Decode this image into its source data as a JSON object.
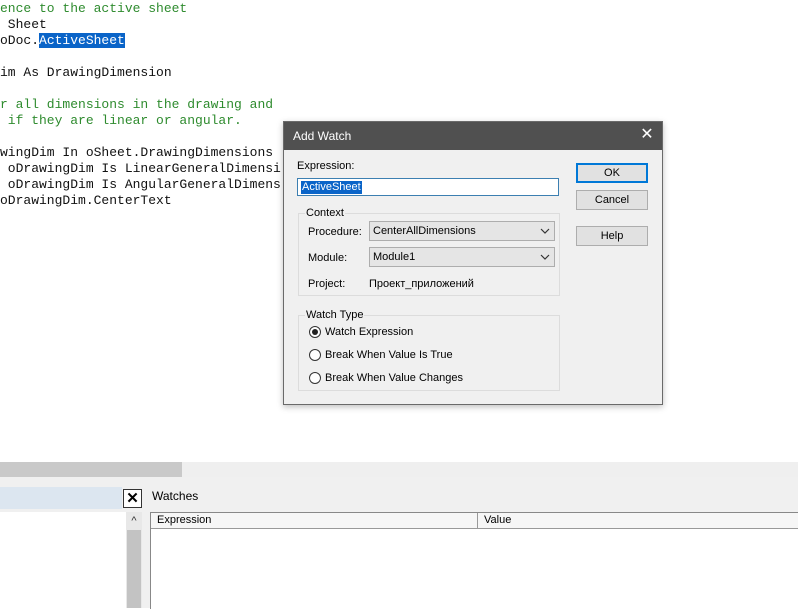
{
  "editor": {
    "lines": [
      {
        "text": "ence to the active sheet",
        "kind": "comment"
      },
      {
        "text": " Sheet",
        "kind": "code"
      },
      {
        "pre": "oDoc.",
        "sel": "ActiveSheet",
        "kind": "selected"
      },
      {
        "text": "",
        "kind": "code"
      },
      {
        "text": "im As DrawingDimension",
        "kind": "code"
      },
      {
        "text": "",
        "kind": "code"
      },
      {
        "text": "r all dimensions in the drawing and",
        "kind": "comment"
      },
      {
        "text": " if they are linear or angular.",
        "kind": "comment"
      },
      {
        "text": "",
        "kind": "code"
      },
      {
        "text": "wingDim In oSheet.DrawingDimensions",
        "kind": "code"
      },
      {
        "text": " oDrawingDim Is LinearGeneralDimensi",
        "kind": "code"
      },
      {
        "text": " oDrawingDim Is AngularGeneralDimens",
        "kind": "code"
      },
      {
        "text": "oDrawingDim.CenterText",
        "kind": "code"
      }
    ]
  },
  "dialog": {
    "title": "Add Watch",
    "close_glyph": "✕",
    "expression_label": "Expression:",
    "expression_value": "ActiveSheet",
    "context": {
      "legend": "Context",
      "procedure_label": "Procedure:",
      "procedure_value": "CenterAllDimensions",
      "module_label": "Module:",
      "module_value": "Module1",
      "project_label": "Project:",
      "project_value": "Проект_приложений"
    },
    "watch_type": {
      "legend": "Watch Type",
      "options": [
        {
          "label": "Watch Expression",
          "checked": true
        },
        {
          "label": "Break When Value Is True",
          "checked": false
        },
        {
          "label": "Break When Value Changes",
          "checked": false
        }
      ]
    },
    "buttons": {
      "ok": "OK",
      "cancel": "Cancel",
      "help": "Help"
    }
  },
  "watches_pane": {
    "title": "Watches",
    "columns": [
      "Expression",
      "Value"
    ]
  },
  "left_pane": {
    "close_glyph": "✕",
    "scroll_up_glyph": "^"
  },
  "colors": {
    "comment": "#2e8b2e",
    "selection": "#0a64c8",
    "dialog_titlebar": "#505050",
    "default_button_border": "#0078d7"
  }
}
